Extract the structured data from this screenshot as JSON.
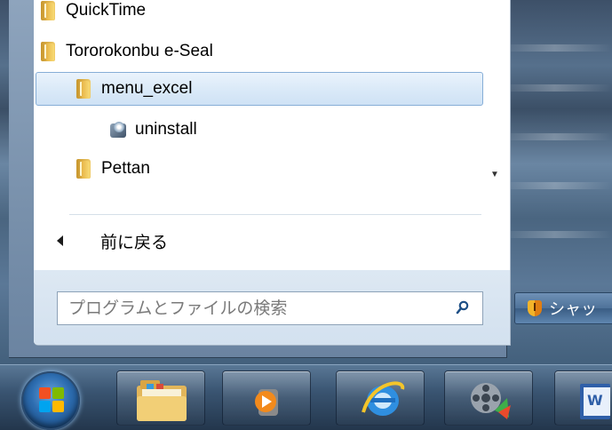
{
  "start_menu": {
    "programs": [
      {
        "label": "QuickTime",
        "level": 0
      },
      {
        "label": "Tororokonbu e-Seal",
        "level": 0
      },
      {
        "label": "menu_excel",
        "level": 1,
        "selected": true
      },
      {
        "label": "uninstall",
        "level": 2
      },
      {
        "label": "Pettan",
        "level": 1
      }
    ],
    "back_label": "前に戻る",
    "search_placeholder": "プログラムとファイルの検索",
    "shutdown_label": "シャッ"
  },
  "taskbar": {
    "items": [
      "start-orb",
      "windows-explorer",
      "media-player",
      "internet-explorer",
      "movie-maker",
      "word"
    ]
  },
  "colors": {
    "selection": "#dbeaf8",
    "selection_border": "#86aed7",
    "search_band": "#d3e1ef"
  }
}
